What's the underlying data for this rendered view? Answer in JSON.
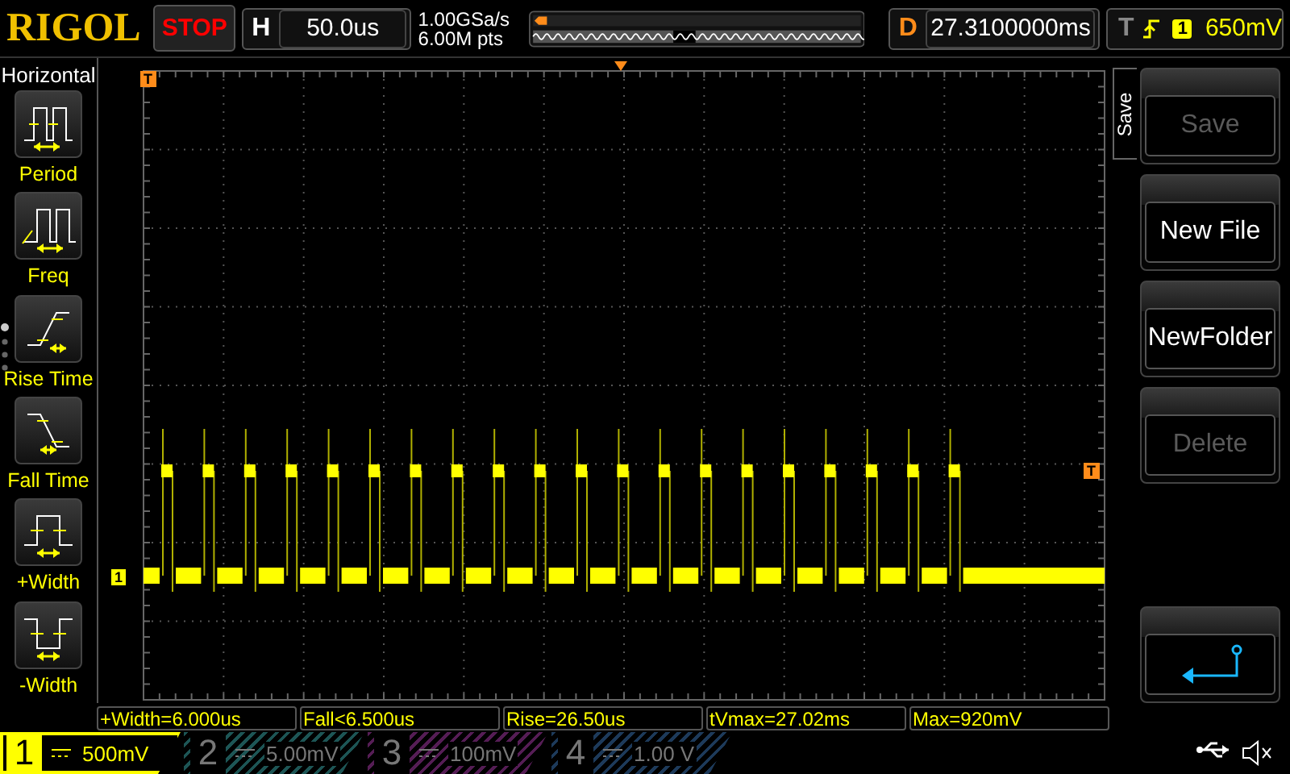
{
  "header": {
    "logo": "RIGOL",
    "run_state": "STOP",
    "timebase": {
      "label": "H",
      "value": "50.0us"
    },
    "sample_rate": "1.00GSa/s",
    "memory_depth": "6.00M pts",
    "delay": {
      "label": "D",
      "value": "27.3100000ms"
    },
    "trigger": {
      "label": "T",
      "source": "1",
      "level": "650mV"
    }
  },
  "measure_menu": {
    "title": "Horizontal",
    "items": [
      {
        "kind": "period",
        "label": "Period"
      },
      {
        "kind": "freq",
        "label": "Freq"
      },
      {
        "kind": "rise",
        "label": "Rise Time"
      },
      {
        "kind": "fall",
        "label": "Fall Time"
      },
      {
        "kind": "pwidth",
        "label": "+Width"
      },
      {
        "kind": "nwidth",
        "label": "-Width"
      }
    ]
  },
  "markers": {
    "trigger_time": "T",
    "trigger_level": "T",
    "channel": "1"
  },
  "softkey_menu": {
    "title": "Save",
    "keys": [
      {
        "kind": "text",
        "label": "Save",
        "disabled": true
      },
      {
        "kind": "text",
        "label": "New File",
        "disabled": false
      },
      {
        "kind": "text",
        "label": "NewFolder",
        "disabled": false
      },
      {
        "kind": "text",
        "label": "Delete",
        "disabled": true
      },
      {
        "kind": "spacer"
      },
      {
        "kind": "return",
        "disabled": false
      }
    ]
  },
  "measurements": [
    "+Width=6.000us",
    "Fall<6.500us",
    "Rise=26.50us",
    "tVmax=27.02ms",
    "Max=920mV"
  ],
  "channels": [
    {
      "number": "1",
      "scale": "500mV",
      "selected": true,
      "color": "#ffff00"
    },
    {
      "number": "2",
      "scale": "5.00mV",
      "selected": false,
      "color": "#1d5555"
    },
    {
      "number": "3",
      "scale": "100mV",
      "selected": false,
      "color": "#551d55"
    },
    {
      "number": "4",
      "scale": "1.00 V",
      "selected": false,
      "color": "#1d3a5a"
    }
  ]
}
